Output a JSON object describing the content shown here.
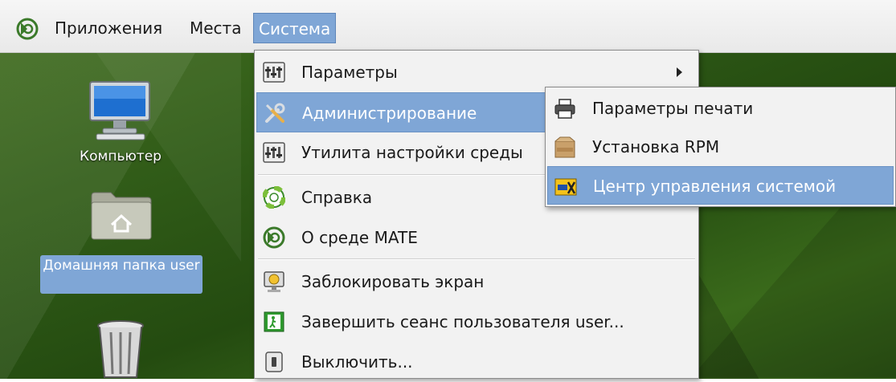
{
  "panel": {
    "applications": "Приложения",
    "places": "Места",
    "system": "Система"
  },
  "desktop": {
    "icons": [
      {
        "label": "Компьютер"
      },
      {
        "label": "Домашняя папка user"
      },
      {
        "label": ""
      }
    ]
  },
  "system_menu": {
    "items": [
      {
        "label": "Параметры",
        "icon": "preferences-icon"
      },
      {
        "label": "Администрирование",
        "icon": "tools-icon"
      },
      {
        "label": "Утилита настройки среды",
        "icon": "control-center-icon"
      },
      {
        "label": "Справка",
        "icon": "help-lifebuoy-icon"
      },
      {
        "label": "О среде MATE",
        "icon": "mate-logo-icon"
      },
      {
        "label": "Заблокировать экран",
        "icon": "lock-screen-icon"
      },
      {
        "label": "Завершить сеанс пользователя user...",
        "icon": "logout-icon"
      },
      {
        "label": "Выключить...",
        "icon": "shutdown-icon"
      }
    ]
  },
  "admin_submenu": {
    "items": [
      {
        "label": "Параметры печати",
        "icon": "printer-icon"
      },
      {
        "label": "Установка RPM",
        "icon": "rpm-package-icon"
      },
      {
        "label": "Центр управления системой",
        "icon": "alt-control-center-icon"
      }
    ]
  },
  "colors": {
    "highlight": "#7fa6d6",
    "menu_bg": "#f2f2f2",
    "desktop_green": "#2f5a17"
  }
}
